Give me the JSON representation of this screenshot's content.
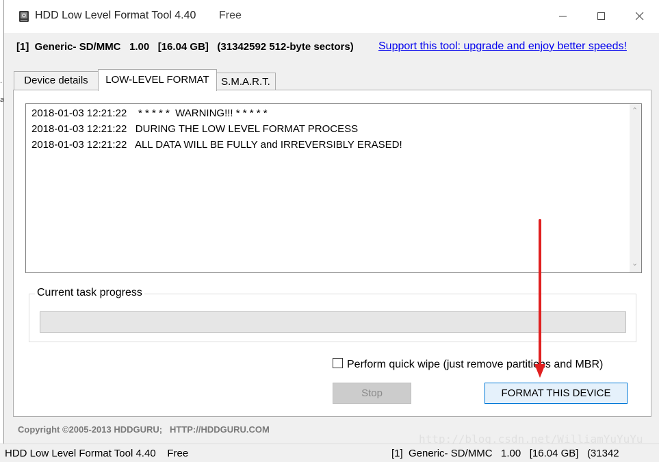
{
  "window": {
    "title": "HDD Low Level Format Tool 4.40",
    "edition": "Free"
  },
  "device_info": "[1]  Generic- SD/MMC   1.00   [16.04 GB]   (31342592 512-byte sectors)",
  "support_link": "Support this tool: upgrade and enjoy better speeds!",
  "tabs": [
    {
      "label": "Device details"
    },
    {
      "label": "LOW-LEVEL FORMAT"
    },
    {
      "label": "S.M.A.R.T."
    }
  ],
  "log": [
    "2018-01-03 12:21:22    * * * * *  WARNING!!! * * * * *",
    "2018-01-03 12:21:22   DURING THE LOW LEVEL FORMAT PROCESS",
    "2018-01-03 12:21:22   ALL DATA WILL BE FULLY and IRREVERSIBLY ERASED!"
  ],
  "progress": {
    "label": "Current task progress",
    "percent": 0
  },
  "quick_wipe": {
    "label": "Perform quick wipe (just remove partitions and MBR)",
    "checked": false
  },
  "buttons": {
    "stop": "Stop",
    "format": "FORMAT THIS DEVICE"
  },
  "copyright": "Copyright ©2005-2013 HDDGURU;   HTTP://HDDGURU.COM",
  "status": {
    "left": "HDD Low Level Format Tool 4.40    Free",
    "right": "[1]  Generic- SD/MMC   1.00   [16.04 GB]   (31342"
  },
  "watermark": "http://blog.csdn.net/WilliamYuYuYu",
  "colors": {
    "accent": "#0078d7",
    "link": "#0000ee",
    "annotation_arrow": "#e02020"
  },
  "icons": [
    "hdd-icon",
    "minimize-icon",
    "maximize-icon",
    "close-icon",
    "scroll-up-icon",
    "scroll-down-icon"
  ]
}
